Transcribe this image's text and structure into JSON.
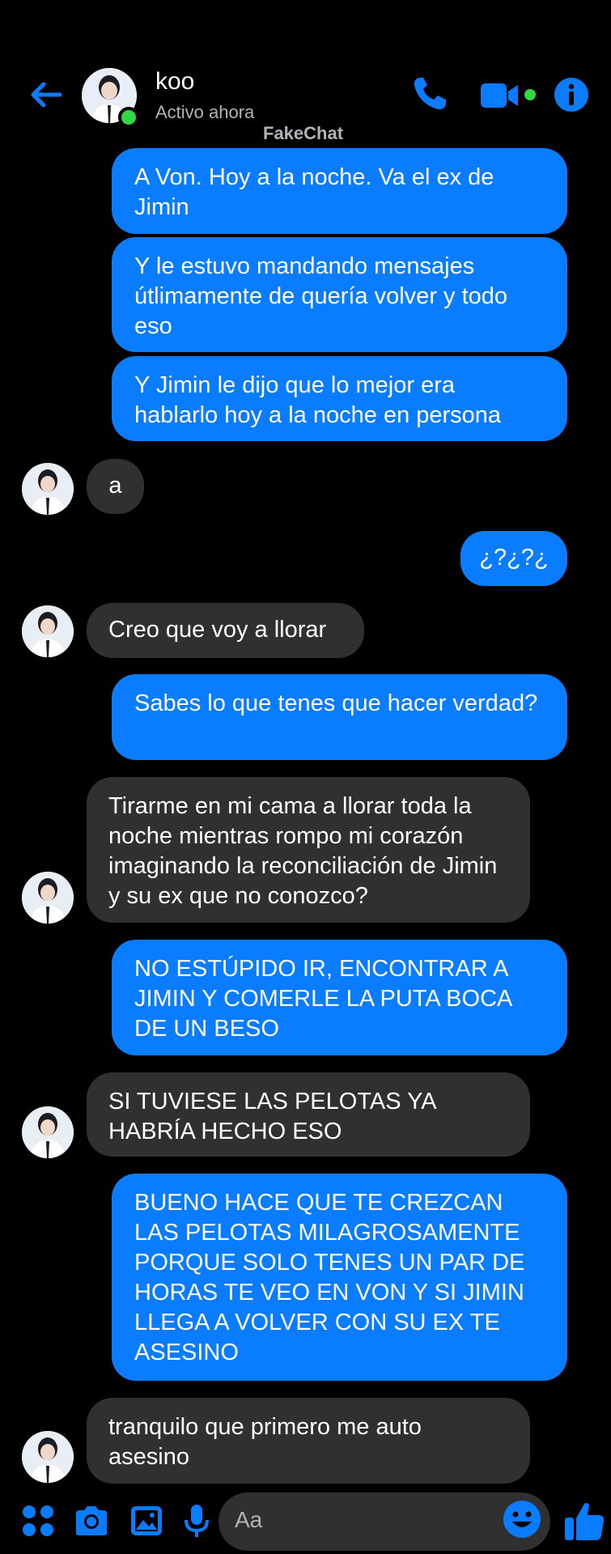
{
  "header": {
    "contact_name": "koo",
    "status": "Activo ahora",
    "watermark": "FakeChat"
  },
  "colors": {
    "accent": "#0a7cff",
    "incoming_bubble": "#303030",
    "online": "#31d843",
    "background": "#000000"
  },
  "messages": [
    {
      "dir": "out",
      "text": "A Von. Hoy a la noche. Va el ex de Jimin"
    },
    {
      "dir": "out",
      "text": "Y le estuvo mandando mensajes útlimamente de quería volver y todo eso"
    },
    {
      "dir": "out",
      "text": "Y Jimin le dijo que lo mejor era hablarlo hoy a la noche en persona"
    },
    {
      "dir": "in",
      "text": "a"
    },
    {
      "dir": "out",
      "text": "¿?¿?¿"
    },
    {
      "dir": "in",
      "text": "Creo que voy a llorar"
    },
    {
      "dir": "out",
      "text": "Sabes lo que tenes que hacer verdad?"
    },
    {
      "dir": "in",
      "text": "Tirarme en mi cama a llorar toda la noche mientras rompo mi corazón imaginando la reconciliación de Jimin y su ex que no conozco?"
    },
    {
      "dir": "out",
      "text": "NO ESTÚPIDO IR, ENCONTRAR A JIMIN Y COMERLE LA PUTA BOCA DE UN BESO"
    },
    {
      "dir": "in",
      "text": "SI TUVIESE LAS PELOTAS YA HABRÍA HECHO ESO"
    },
    {
      "dir": "out",
      "text": "BUENO HACE QUE TE CREZCAN LAS PELOTAS MILAGROSAMENTE PORQUE SOLO TENES UN PAR DE HORAS TE VEO EN VON Y SI JIMIN LLEGA A VOLVER CON SU EX TE ASESINO"
    },
    {
      "dir": "in",
      "text": "tranquilo que primero me auto asesino"
    }
  ],
  "composer": {
    "placeholder": "Aa",
    "icons": [
      "apps-icon",
      "camera-icon",
      "gallery-icon",
      "microphone-icon",
      "emoji-icon",
      "thumbs-up-icon"
    ]
  }
}
